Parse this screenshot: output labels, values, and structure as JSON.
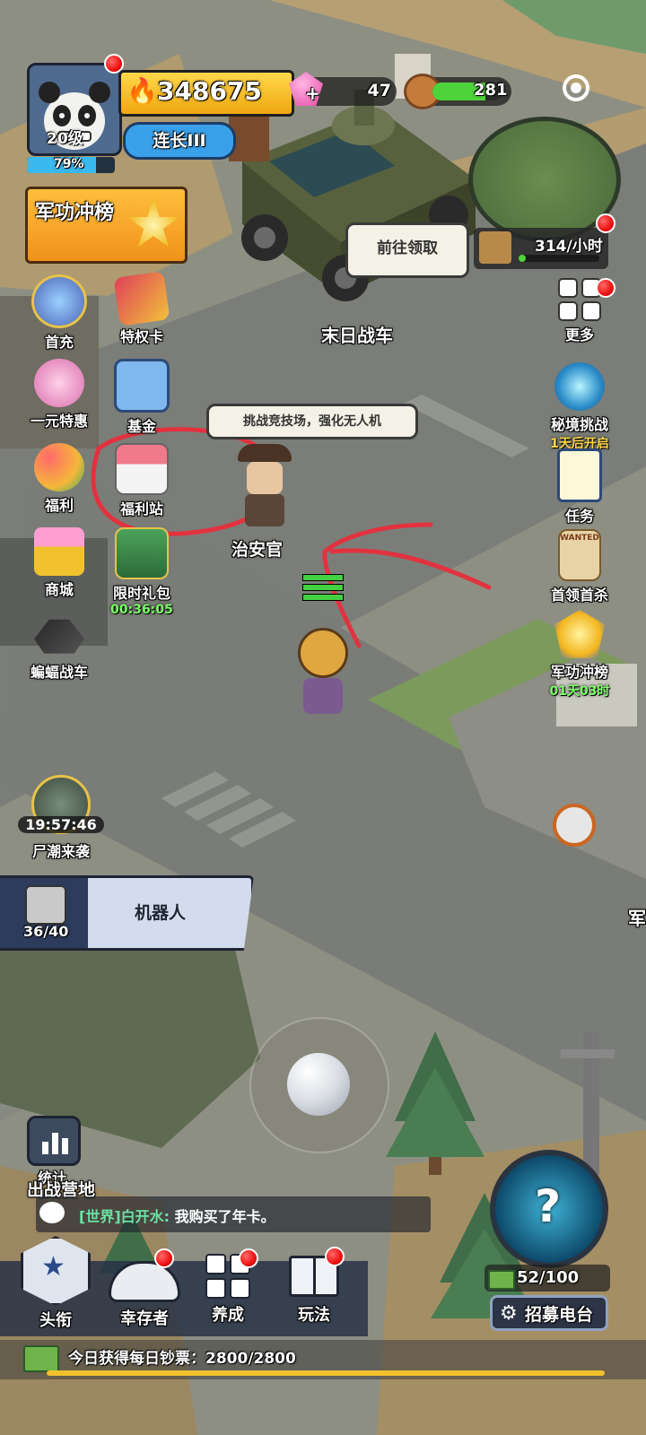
{
  "player": {
    "level": "20级",
    "exp_percent": "79%",
    "exp_fraction": 0.79,
    "power": "348675",
    "rank": "连长III"
  },
  "resources": {
    "gems": "47",
    "wood": "281",
    "wood_fill": 0.75
  },
  "events": {
    "banner_title": "军功冲榜"
  },
  "map": {
    "vehicle_name": "末日战车",
    "collect_bubble": "前往领取",
    "rate": "314/小时",
    "npc_bubble": "挑战竞技场，强化无人机",
    "npc_name": "治安官",
    "horde_timer": "19:57:46",
    "horde_label": "尸潮来袭",
    "edge_label": "军"
  },
  "left_menu": [
    {
      "label": "首充",
      "icon": "robot-mech-icon"
    },
    {
      "label": "特权卡",
      "icon": "privilege-card-icon"
    },
    {
      "label": "一元特惠",
      "icon": "crown-deal-icon"
    },
    {
      "label": "基金",
      "icon": "fund-book-icon"
    },
    {
      "label": "福利",
      "icon": "balloon-basket-icon"
    },
    {
      "label": "福利站",
      "icon": "shop-stall-icon"
    },
    {
      "label": "商城",
      "icon": "mall-basket-icon"
    },
    {
      "label": "限时礼包",
      "icon": "gift-pack-icon",
      "timer": "00:36:05"
    },
    {
      "label": "蝙蝠战车",
      "icon": "bat-vehicle-icon"
    }
  ],
  "right_menu": [
    {
      "label": "更多",
      "icon": "grid-more-icon"
    },
    {
      "label": "秘境挑战",
      "icon": "portal-icon",
      "sub": "1天后开启"
    },
    {
      "label": "任务",
      "icon": "task-list-icon"
    },
    {
      "label": "首领首杀",
      "icon": "wanted-poster-icon",
      "poster_text": "WANTED"
    },
    {
      "label": "军功冲榜",
      "icon": "medal-rank-icon",
      "sub": "01天03时"
    }
  ],
  "robot_panel": {
    "count": "36/40",
    "title": "机器人"
  },
  "stats": {
    "label": "统计"
  },
  "camp": {
    "label": "出战营地"
  },
  "chat": {
    "channel": "[世界]",
    "user": "白开水:",
    "message": "我购买了年卡。"
  },
  "bottom_nav": [
    {
      "label": "头衔",
      "icon": "star-badge-icon"
    },
    {
      "label": "幸存者",
      "icon": "cowboy-hat-icon"
    },
    {
      "label": "养成",
      "icon": "grid-squares-icon"
    },
    {
      "label": "玩法",
      "icon": "open-book-icon"
    }
  ],
  "recruit": {
    "count": "52/100",
    "label": "招募电台"
  },
  "daily": {
    "text": "今日获得每日钞票：2800/2800",
    "fill": 1.0
  },
  "colors": {
    "power_bg": "#f5c21b",
    "rank_bg": "#3aa0ea",
    "exp_bar": "#39b9f0",
    "wood_bar": "#4fd33a",
    "banner": "#f6a21c",
    "annotation_red": "#e2323f"
  }
}
